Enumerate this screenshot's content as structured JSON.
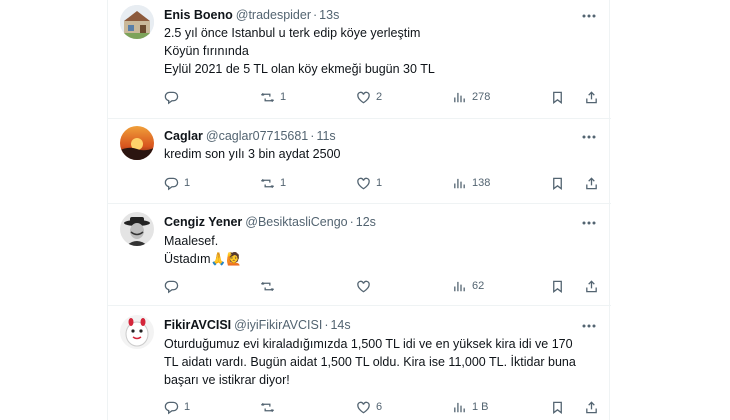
{
  "tweets": [
    {
      "name": "Enis Boeno",
      "handle": "@tradespider",
      "separator": "·",
      "time": "13s",
      "lines": [
        "2.5 yıl önce Istanbul u terk edip köye yerleştim",
        "Köyün fırınında",
        "Eylül 2021 de 5 TL olan köy ekmeği bugün 30 TL"
      ],
      "replies": "",
      "retweets": "1",
      "likes": "2",
      "views": "278"
    },
    {
      "name": "Caglar",
      "handle": "@caglar07715681",
      "separator": "·",
      "time": "11s",
      "lines": [
        "kredim son yılı 3 bin aydat 2500"
      ],
      "replies": "1",
      "retweets": "1",
      "likes": "1",
      "views": "138"
    },
    {
      "name": "Cengiz Yener",
      "handle": "@BesiktasliCengo",
      "separator": "·",
      "time": "12s",
      "lines": [
        "Maalesef.",
        "Üstadım🙏🙋"
      ],
      "replies": "",
      "retweets": "",
      "likes": "",
      "views": "62"
    },
    {
      "name": "FikirAVCISI",
      "handle": "@iyiFikirAVCISI",
      "separator": "·",
      "time": "14s",
      "lines": [
        "Oturduğumuz evi kiraladığımızda 1,500 TL idi ve en yüksek kira idi ve 170",
        "TL aidatı vardı. Bugün aidat 1,500 TL oldu. Kira ise 11,000 TL. İktidar buna",
        "başarı ve istikrar diyor!"
      ],
      "replies": "1",
      "retweets": "",
      "likes": "6",
      "views": "1 B"
    }
  ],
  "colors": {
    "text": "#0f1419",
    "secondary": "#536471",
    "border": "#eff3f4"
  },
  "icons": [
    "reply-icon",
    "retweet-icon",
    "like-icon",
    "views-icon",
    "bookmark-icon",
    "share-icon",
    "more-icon"
  ]
}
